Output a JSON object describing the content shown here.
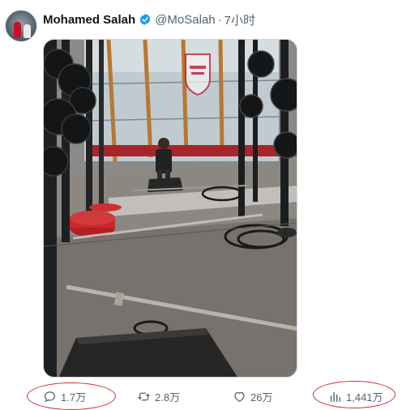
{
  "tweet": {
    "author_name": "Mohamed Salah",
    "handle": "@MoSalah",
    "separator": "·",
    "time": "7小时",
    "media_icon": "photo",
    "colors": {
      "verified": "#1d9bf0",
      "annotation_ring": "#d22b2b",
      "meta_text": "#536471"
    }
  },
  "actions": {
    "reply": {
      "icon": "reply-icon",
      "count": "1.7万"
    },
    "retweet": {
      "icon": "retweet-icon",
      "count": "2.8万"
    },
    "like": {
      "icon": "heart-icon",
      "count": "26万"
    },
    "views": {
      "icon": "views-chart-icon",
      "count": "1,441万"
    }
  }
}
